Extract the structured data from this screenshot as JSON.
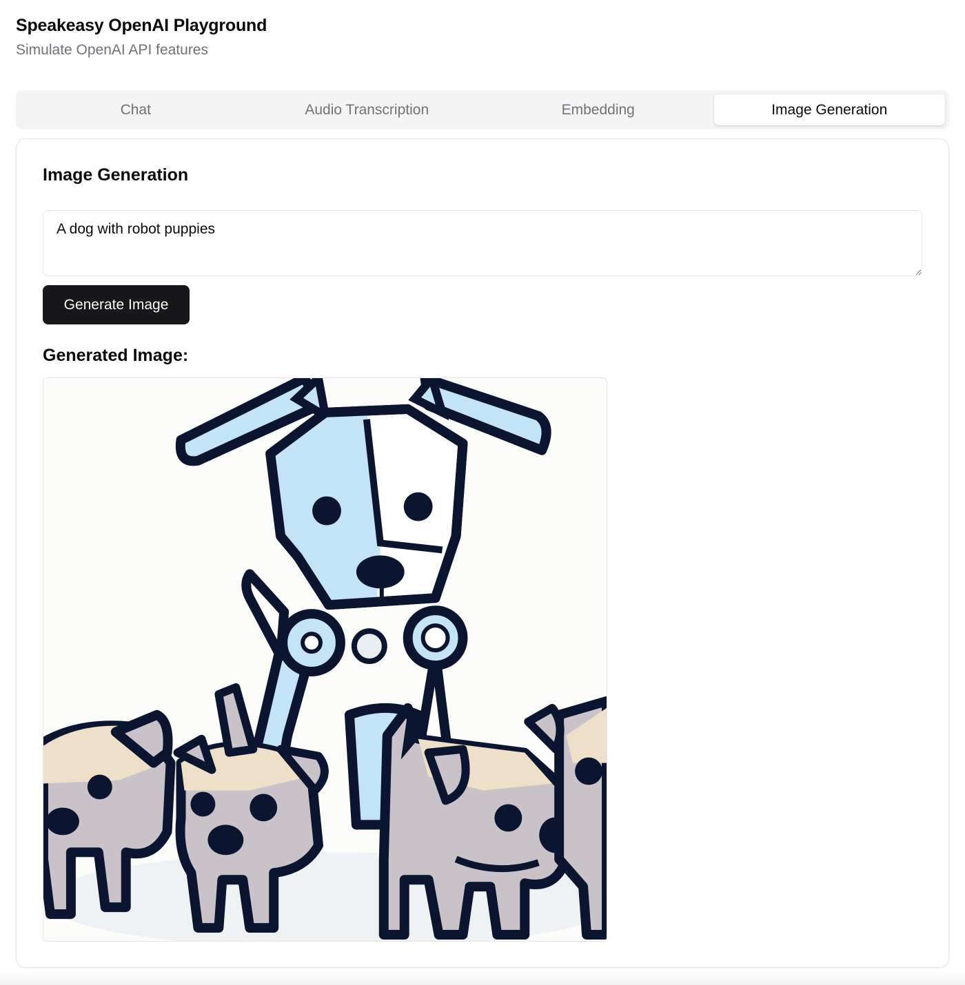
{
  "app": {
    "title": "Speakeasy OpenAI Playground",
    "subtitle": "Simulate OpenAI API features"
  },
  "tabs": [
    {
      "label": "Chat",
      "active": false
    },
    {
      "label": "Audio Transcription",
      "active": false
    },
    {
      "label": "Embedding",
      "active": false
    },
    {
      "label": "Image Generation",
      "active": true
    }
  ],
  "panel": {
    "title": "Image Generation",
    "prompt_value": "A dog with robot puppies",
    "generate_label": "Generate Image",
    "result_title": "Generated Image:"
  },
  "colors": {
    "primary_button": "#18181b",
    "tab_bar": "#f4f4f5",
    "muted_text": "#71717a",
    "robot_blue": "#c3e3f7",
    "outline": "#0b1530",
    "puppy_grey": "#c9c3c9",
    "puppy_tan": "#eee0c8"
  }
}
